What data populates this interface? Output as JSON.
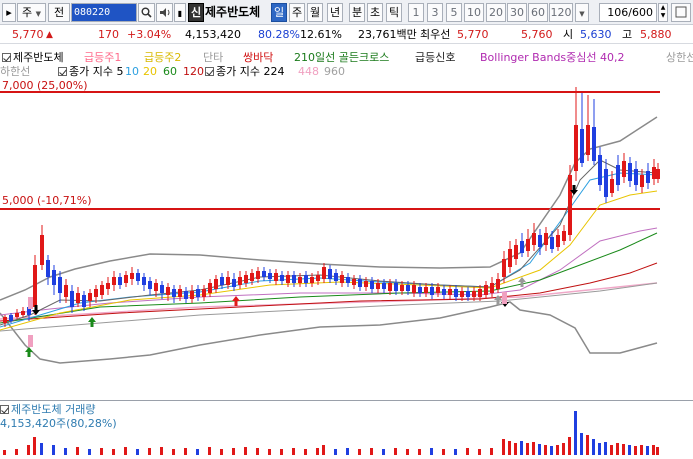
{
  "toolbar": {
    "period_label": "주",
    "dropdown_label": "전",
    "stock_code": "080220",
    "stock_name": "제주반도체",
    "badge": "신",
    "timeframes": [
      "일",
      "주",
      "월",
      "년",
      "분",
      "초",
      "틱"
    ],
    "active_timeframe": "일",
    "minute_values": [
      "1",
      "3",
      "5",
      "10",
      "20",
      "30",
      "60",
      "120"
    ],
    "count_value": "106/600"
  },
  "quote": {
    "price": "5,770",
    "change": "170",
    "change_pct": "+3.04%",
    "volume": "4,153,420",
    "vol_ratio": "80.28%",
    "turnover": "12.61%",
    "amount": "23,761백만",
    "best_label": "최우선",
    "best_value": "5,770",
    "ask_value": "5,760",
    "open_label": "시",
    "open_value": "5,630",
    "high_label": "고",
    "high_value": "5,880"
  },
  "legend": {
    "stock": "제주반도체",
    "ind1": "급등주1",
    "ind2": "급등주2",
    "ind3": "단타",
    "ind4": "쌍바닥",
    "ind5": "210일선 골든크로스",
    "ind6": "급등신호",
    "ind7": "Bollinger Bands중심선 40,2",
    "ind8": "상한선",
    "row2_lower": "하한선",
    "row2_ma_label": "종가 지수 5",
    "ma10": "10",
    "ma20": "20",
    "ma60": "60",
    "ma120": "120",
    "row2_ma2_label": "종가 지수 224",
    "ma448": "448",
    "ma960": "960"
  },
  "price_levels": {
    "upper": "7,000 (25,00%)",
    "lower": "5,000 (-10,71%)"
  },
  "volume_panel": {
    "title": "제주반도체 거래량",
    "value": "4,153,420주(80,28%)"
  },
  "colors": {
    "up": "#e01818",
    "down": "#1f3fe0",
    "level_line": "#d61414",
    "bb": "#808080",
    "accent": "#2d67c4"
  },
  "icons": [
    "search-icon",
    "speaker-icon",
    "lock-icon",
    "chevron-down-icon",
    "spinner-icon"
  ]
}
